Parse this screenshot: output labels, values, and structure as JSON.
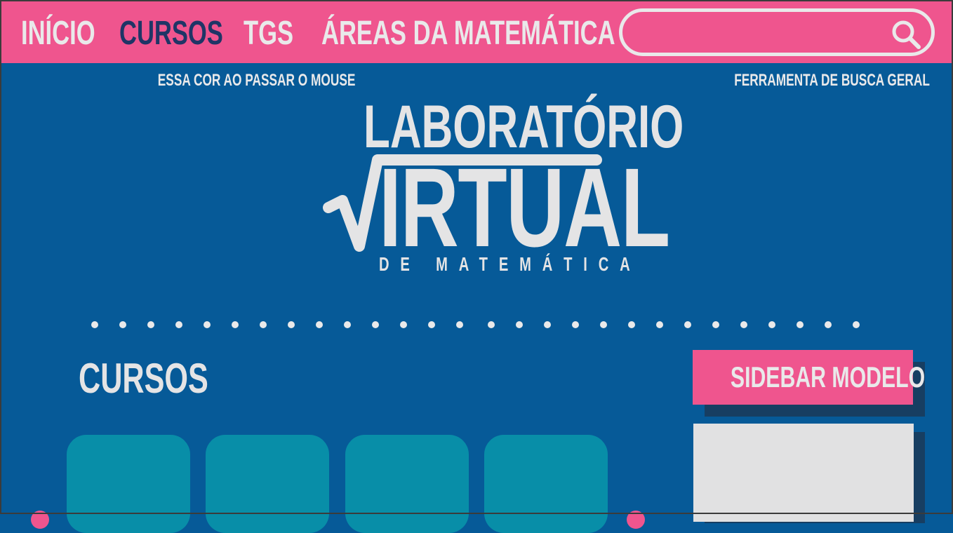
{
  "nav": {
    "items": [
      {
        "label": "INÍCIO",
        "active": false
      },
      {
        "label": "CURSOS",
        "active": true
      },
      {
        "label": "TGS",
        "active": false
      },
      {
        "label": "ÁREAS DA MATEMÁTICA",
        "active": false
      }
    ],
    "search": {
      "icon": "search-icon",
      "placeholder": ""
    }
  },
  "notes": {
    "hover_color": "ESSA COR AO PASSAR O MOUSE",
    "search": "FERRAMENTA DE BUSCA GERAL"
  },
  "logo": {
    "top": "LABORATÓRIO",
    "main": "IRTUAL",
    "sub": "DE MATEMÁTICA"
  },
  "courses": {
    "title": "CURSOS",
    "cards": [
      {},
      {},
      {},
      {}
    ]
  },
  "sidebar": {
    "title": "SIDEBAR MODELO"
  },
  "colors": {
    "background": "#065a98",
    "nav": "#ef558e",
    "active": "#1f3566",
    "text": "#e9e9ea",
    "card": "#088ea8",
    "sidebar_box": "#e1e1e2"
  }
}
